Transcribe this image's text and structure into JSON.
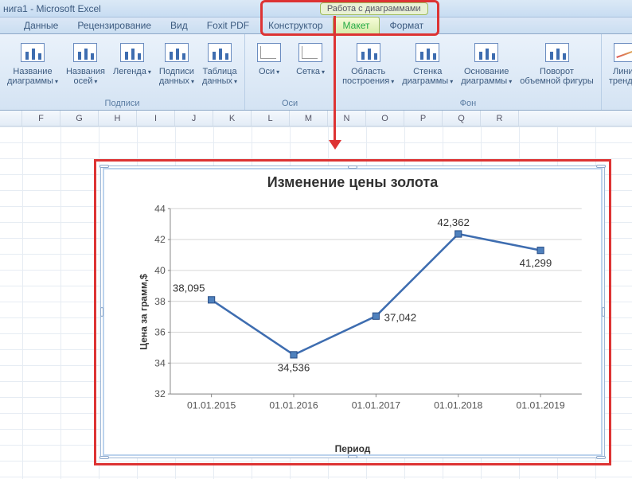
{
  "window_title": "нига1 - Microsoft Excel",
  "chart_tools_label": "Работа с диаграммами",
  "tabs": [
    "Данные",
    "Рецензирование",
    "Вид",
    "Foxit PDF",
    "Конструктор",
    "Макет",
    "Формат"
  ],
  "active_tab_index": 5,
  "ribbon": {
    "groups": [
      {
        "name": "Подписи",
        "buttons": [
          {
            "label": "Название",
            "label2": "диаграммы",
            "dd": true
          },
          {
            "label": "Названия",
            "label2": "осей",
            "dd": true
          },
          {
            "label": "Легенда",
            "label2": "",
            "dd": true
          },
          {
            "label": "Подписи",
            "label2": "данных",
            "dd": true
          },
          {
            "label": "Таблица",
            "label2": "данных",
            "dd": true
          }
        ]
      },
      {
        "name": "Оси",
        "buttons": [
          {
            "label": "Оси",
            "label2": "",
            "dd": true
          },
          {
            "label": "Сетка",
            "label2": "",
            "dd": true
          }
        ]
      },
      {
        "name": "Фон",
        "buttons": [
          {
            "label": "Область",
            "label2": "построения",
            "dd": true
          },
          {
            "label": "Стенка",
            "label2": "диаграммы",
            "dd": true
          },
          {
            "label": "Основание",
            "label2": "диаграммы",
            "dd": true
          },
          {
            "label": "Поворот",
            "label2": "объемной фигуры",
            "dd": false
          }
        ]
      },
      {
        "name": "",
        "buttons": [
          {
            "label": "Линия",
            "label2": "тренда",
            "dd": true
          }
        ]
      }
    ]
  },
  "columns": [
    "F",
    "G",
    "H",
    "I",
    "J",
    "K",
    "L",
    "M",
    "N",
    "O",
    "P",
    "Q",
    "R"
  ],
  "chart_data": {
    "type": "line",
    "title": "Изменение цены золота",
    "xlabel": "Период",
    "ylabel": "Цена за грамм,$",
    "ylim": [
      32,
      44
    ],
    "yticks": [
      32,
      34,
      36,
      38,
      40,
      42,
      44
    ],
    "categories": [
      "01.01.2015",
      "01.01.2016",
      "01.01.2017",
      "01.01.2018",
      "01.01.2019"
    ],
    "values": [
      38.095,
      34.536,
      37.042,
      42.362,
      41.299
    ],
    "labels": [
      "38,095",
      "34,536",
      "37,042",
      "42,362",
      "41,299"
    ]
  }
}
